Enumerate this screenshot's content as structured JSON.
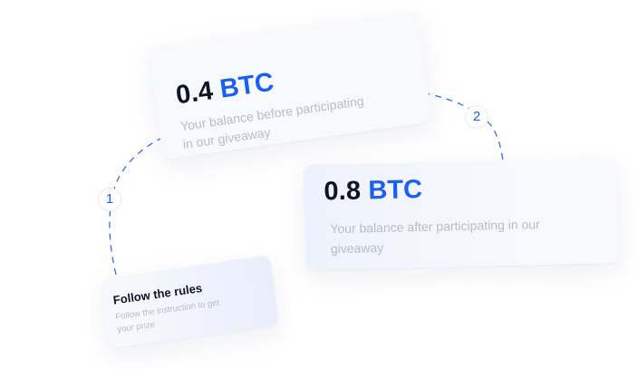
{
  "card_before": {
    "amount": "0.4",
    "currency": "BTC",
    "description": "Your balance before participating in our giveaway"
  },
  "card_after": {
    "amount": "0.8",
    "currency": "BTC",
    "description": "Your balance after participating in our giveaway"
  },
  "rules_card": {
    "title": "Follow the rules",
    "description": "Follow the instruction to get your prize"
  },
  "steps": {
    "one": "1",
    "two": "2"
  },
  "colors": {
    "accent": "#1a5ff0",
    "dark_text": "#0e1426",
    "muted_text": "#b6bcc9",
    "card_bg": "#f7f9fd"
  }
}
